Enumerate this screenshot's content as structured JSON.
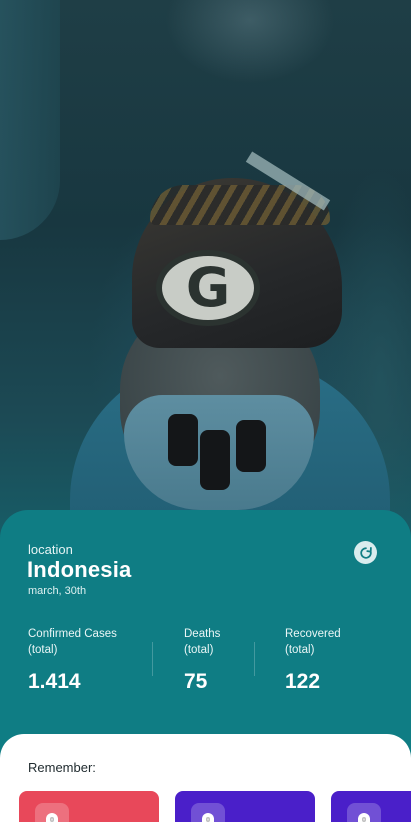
{
  "location": {
    "label": "location",
    "name": "Indonesia",
    "date": "march, 30th"
  },
  "stats": [
    {
      "label": "Confirmed Cases",
      "sub": "(total)",
      "value": "1.414"
    },
    {
      "label": "Deaths",
      "sub": "(total)",
      "value": "75"
    },
    {
      "label": "Recovered",
      "sub": "(total)",
      "value": "122"
    }
  ],
  "remember": {
    "title": "Remember:",
    "cards": [
      {
        "color": "#e8485a",
        "icon": "tip-icon"
      },
      {
        "color": "#4a1fc9",
        "icon": "tip-icon"
      },
      {
        "color": "#4a1fc9",
        "icon": "tip-icon"
      }
    ]
  },
  "colors": {
    "card_teal": "#0f7d84",
    "accent_red": "#e8485a",
    "accent_purple": "#4a1fc9"
  },
  "icons": {
    "refresh": "refresh-icon"
  }
}
